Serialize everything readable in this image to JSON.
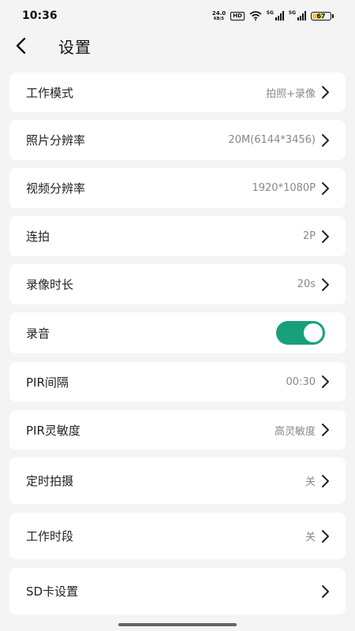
{
  "status_bar": {
    "time": "10:36",
    "net_speed": "24.0",
    "net_unit": "KB/S",
    "hd_label": "HD",
    "sim1_tag": "5G",
    "sim2_tag": "5G",
    "battery": "67",
    "battery_level_percent": 67
  },
  "header": {
    "title": "设置",
    "back_icon": "chevron-left-icon"
  },
  "settings": {
    "work_mode": {
      "label": "工作模式",
      "value": "拍照+录像"
    },
    "photo_resolution": {
      "label": "照片分辨率",
      "value": "20M(6144*3456)"
    },
    "video_resolution": {
      "label": "视频分辨率",
      "value": "1920*1080P"
    },
    "burst": {
      "label": "连拍",
      "value": "2P"
    },
    "record_duration": {
      "label": "录像时长",
      "value": "20s"
    },
    "audio": {
      "label": "录音",
      "enabled": true
    },
    "pir_interval": {
      "label": "PIR间隔",
      "value": "00:30"
    },
    "pir_sensitivity": {
      "label": "PIR灵敏度",
      "value": "高灵敏度"
    },
    "timed_capture": {
      "label": "定时拍摄",
      "value": "关"
    },
    "work_period": {
      "label": "工作时段",
      "value": "关"
    },
    "sd_card": {
      "label": "SD卡设置"
    }
  },
  "colors": {
    "accent": "#18a07a",
    "background": "#f4f4f4",
    "card": "#ffffff",
    "value_text": "#888888"
  }
}
